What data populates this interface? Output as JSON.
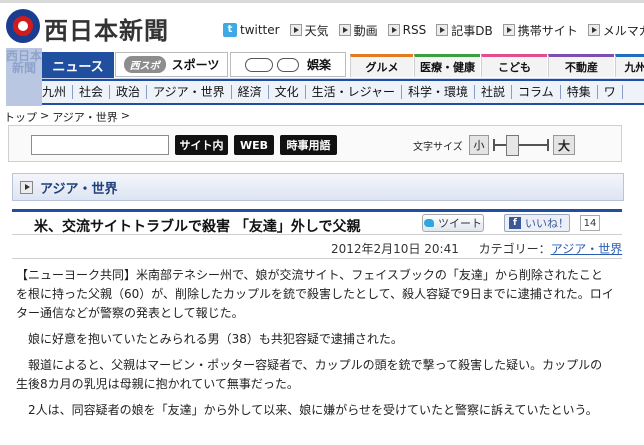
{
  "site": {
    "logo_text": "西日本新聞"
  },
  "header_links": [
    {
      "label": "twitter",
      "icon": "twitter-icon"
    },
    {
      "label": "天気",
      "icon": "arrow-right-icon"
    },
    {
      "label": "動画",
      "icon": "arrow-right-icon"
    },
    {
      "label": "RSS",
      "icon": "arrow-right-icon"
    },
    {
      "label": "記事DB",
      "icon": "arrow-right-icon"
    },
    {
      "label": "携帯サイト",
      "icon": "arrow-right-icon"
    },
    {
      "label": "メルマガ",
      "icon": "arrow-right-icon"
    }
  ],
  "side_label": "西日本新聞",
  "tabs": {
    "news": "ニュース",
    "sports_pill": "西スポ",
    "sports": "スポーツ",
    "entertainment": "娯楽",
    "gourmet": "グルメ",
    "health": "医療・健康",
    "kids": "こども",
    "estate": "不動産",
    "kyushu": "九州"
  },
  "subnav": [
    "九州",
    "社会",
    "政治",
    "アジア・世界",
    "経済",
    "文化",
    "生活・レジャー",
    "科学・環境",
    "社説",
    "コラム",
    "特集",
    "ワ"
  ],
  "breadcrumb": {
    "home": "トップ",
    "sep": ">",
    "current": "アジア・世界",
    "trail_sep": ">"
  },
  "search": {
    "value": "",
    "btn_site": "サイト内",
    "btn_web": "WEB",
    "btn_term": "時事用語",
    "font_size_label": "文字サイズ",
    "font_small": "小",
    "font_large": "大"
  },
  "section": {
    "title": "アジア・世界"
  },
  "article": {
    "title": "米、交流サイトトラブルで殺害 「友達」外しで父親",
    "tweet": "ツイート",
    "like": "いいね！",
    "like_count": "14",
    "date": "2012年2月10日 20:41",
    "category_label": "カテゴリー：",
    "category": "アジア・世界",
    "paragraphs": [
      "【ニューヨーク共同】米南部テネシー州で、娘が交流サイト、フェイスブックの「友達」から削除されたことを根に持った父親（60）が、削除したカップルを銃で殺害したとして、殺人容疑で9日までに逮捕された。ロイター通信などが警察の発表として報じた。",
      "娘に好意を抱いていたとみられる男（38）も共犯容疑で逮捕された。",
      "報道によると、父親はマービン・ポッター容疑者で、カップルの頭を銃で撃って殺害した疑い。カップルの生後8カ月の乳児は母親に抱かれていて無事だった。",
      "2人は、同容疑者の娘を「友達」から外して以来、娘に嫌がらせを受けていたと警察に訴えていたという。"
    ]
  }
}
